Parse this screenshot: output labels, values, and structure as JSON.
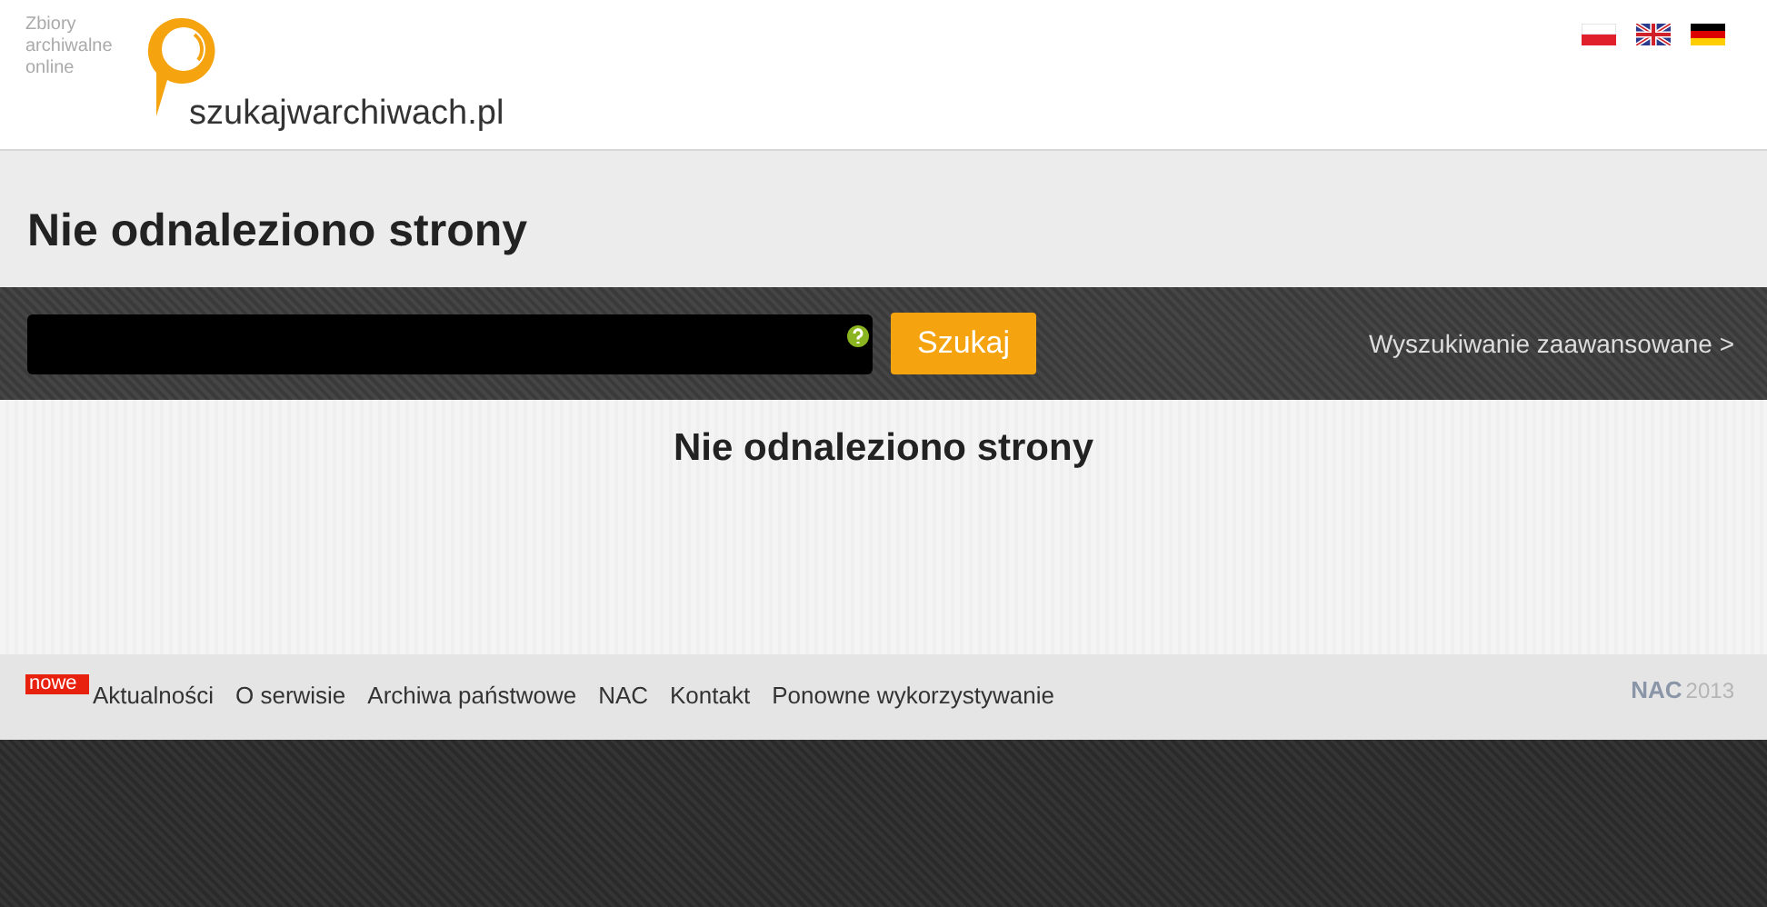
{
  "header": {
    "tagline": "Zbiory archiwalne online",
    "site_name": "szukajwarchiwach.pl",
    "languages": [
      {
        "kind": "pl"
      },
      {
        "kind": "en"
      },
      {
        "kind": "de"
      }
    ]
  },
  "page_title": "Nie odnaleziono strony",
  "search": {
    "button": "Szukaj",
    "advanced_link": "Wyszukiwanie zaawansowane >"
  },
  "content": {
    "heading": "Nie odnaleziono strony"
  },
  "footer": {
    "badge": "nowe",
    "links": [
      "Aktualności",
      "O serwisie",
      "Archiwa państwowe",
      "NAC",
      "Kontakt",
      "Ponowne wykorzystywanie"
    ],
    "logo": "NAC",
    "year": "2013"
  }
}
